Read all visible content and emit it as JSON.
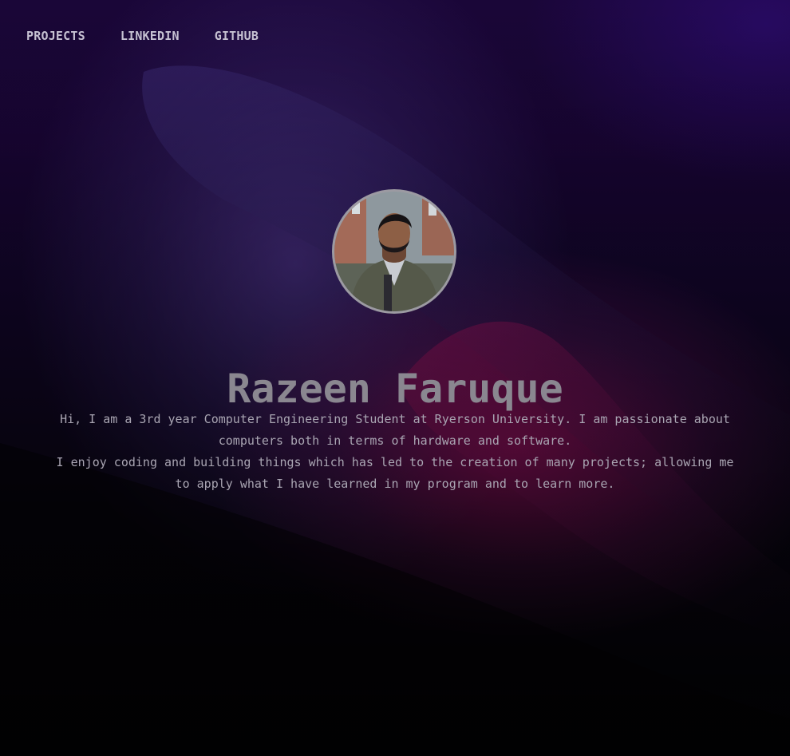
{
  "nav": {
    "projects": "PROJECTS",
    "linkedin": "LINKEDIN",
    "github": "GITHUB"
  },
  "profile": {
    "name": "Razeen Faruque",
    "bio_line1": "Hi, I am a 3rd year Computer Engineering Student at Ryerson University. I am passionate about computers both in terms of hardware and software.",
    "bio_line2": "I enjoy coding and building things which has led to the creation of many projects; allowing me to apply what I have learned in my program and to learn more."
  },
  "colors": {
    "background_top": "#1a0638",
    "background_bottom": "#040307",
    "accent_magenta": "#ba126e",
    "accent_purple": "#483082",
    "nav_text": "#c6c1d2",
    "name_text": "#8a8790",
    "bio_text": "#a9a5b2"
  }
}
